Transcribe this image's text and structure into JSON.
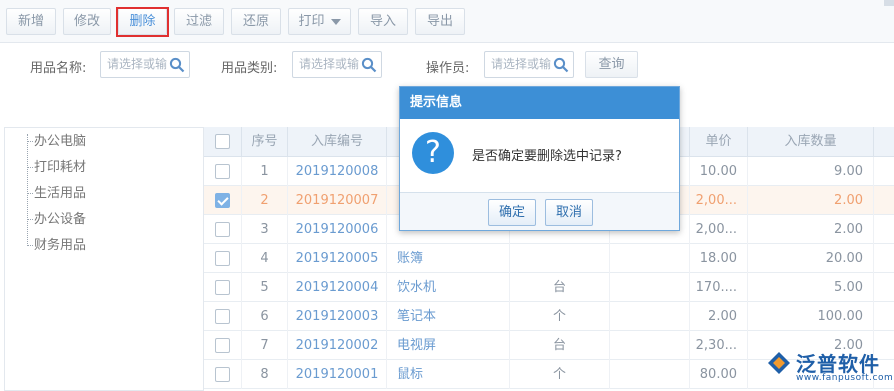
{
  "toolbar": {
    "buttons": [
      {
        "label": "新增"
      },
      {
        "label": "修改"
      },
      {
        "label": "删除"
      },
      {
        "label": "过滤"
      },
      {
        "label": "还原"
      },
      {
        "label": "打印"
      },
      {
        "label": "导入"
      },
      {
        "label": "导出"
      }
    ]
  },
  "filters": {
    "name_label": "用品名称:",
    "name_placeholder": "请选择或输",
    "category_label": "用品类别:",
    "category_placeholder": "请选择或输",
    "operator_label": "操作员:",
    "operator_placeholder": "请选择或输",
    "query_label": "查询"
  },
  "tree": {
    "items": [
      "办公电脑",
      "打印耗材",
      "生活用品",
      "办公设备",
      "财务用品"
    ]
  },
  "grid": {
    "headers": {
      "seq": "序号",
      "code": "入库编号",
      "unit_price": "单价",
      "quantity": "入库数量"
    },
    "rows": [
      {
        "seq": "1",
        "code": "2019120008",
        "name": "",
        "unit": "",
        "spec": "",
        "price": "10.00",
        "qty": "9.00",
        "checked": false
      },
      {
        "seq": "2",
        "code": "2019120007",
        "name": "",
        "unit": "",
        "spec": "",
        "price": "2,00...",
        "qty": "2.00",
        "checked": true
      },
      {
        "seq": "3",
        "code": "2019120006",
        "name": "",
        "unit": "",
        "spec": "",
        "price": "2,00...",
        "qty": "2.00",
        "checked": false
      },
      {
        "seq": "4",
        "code": "2019120005",
        "name": "账簿",
        "unit": "",
        "spec": "",
        "price": "18.00",
        "qty": "20.00",
        "checked": false
      },
      {
        "seq": "5",
        "code": "2019120004",
        "name": "饮水机",
        "unit": "台",
        "spec": "",
        "price": "170....",
        "qty": "5.00",
        "checked": false
      },
      {
        "seq": "6",
        "code": "2019120003",
        "name": "笔记本",
        "unit": "个",
        "spec": "",
        "price": "2.00",
        "qty": "100.00",
        "checked": false
      },
      {
        "seq": "7",
        "code": "2019120002",
        "name": "电视屏",
        "unit": "台",
        "spec": "",
        "price": "2,30...",
        "qty": "2.00",
        "checked": false
      },
      {
        "seq": "8",
        "code": "2019120001",
        "name": "鼠标",
        "unit": "个",
        "spec": "",
        "price": "80.00",
        "qty": "",
        "checked": false
      }
    ]
  },
  "dialog": {
    "title": "提示信息",
    "icon": "?",
    "message": "是否确定要删除选中记录?",
    "ok_label": "确定",
    "cancel_label": "取消"
  },
  "logo": {
    "name": "泛普软件",
    "url": "www.fanpusoft.com"
  },
  "colors": {
    "dialog_header": "#3d8fd6",
    "highlight_box": "#e03030",
    "selected_row": "#fdf5ee",
    "link_blue": "#6a9bd0"
  }
}
